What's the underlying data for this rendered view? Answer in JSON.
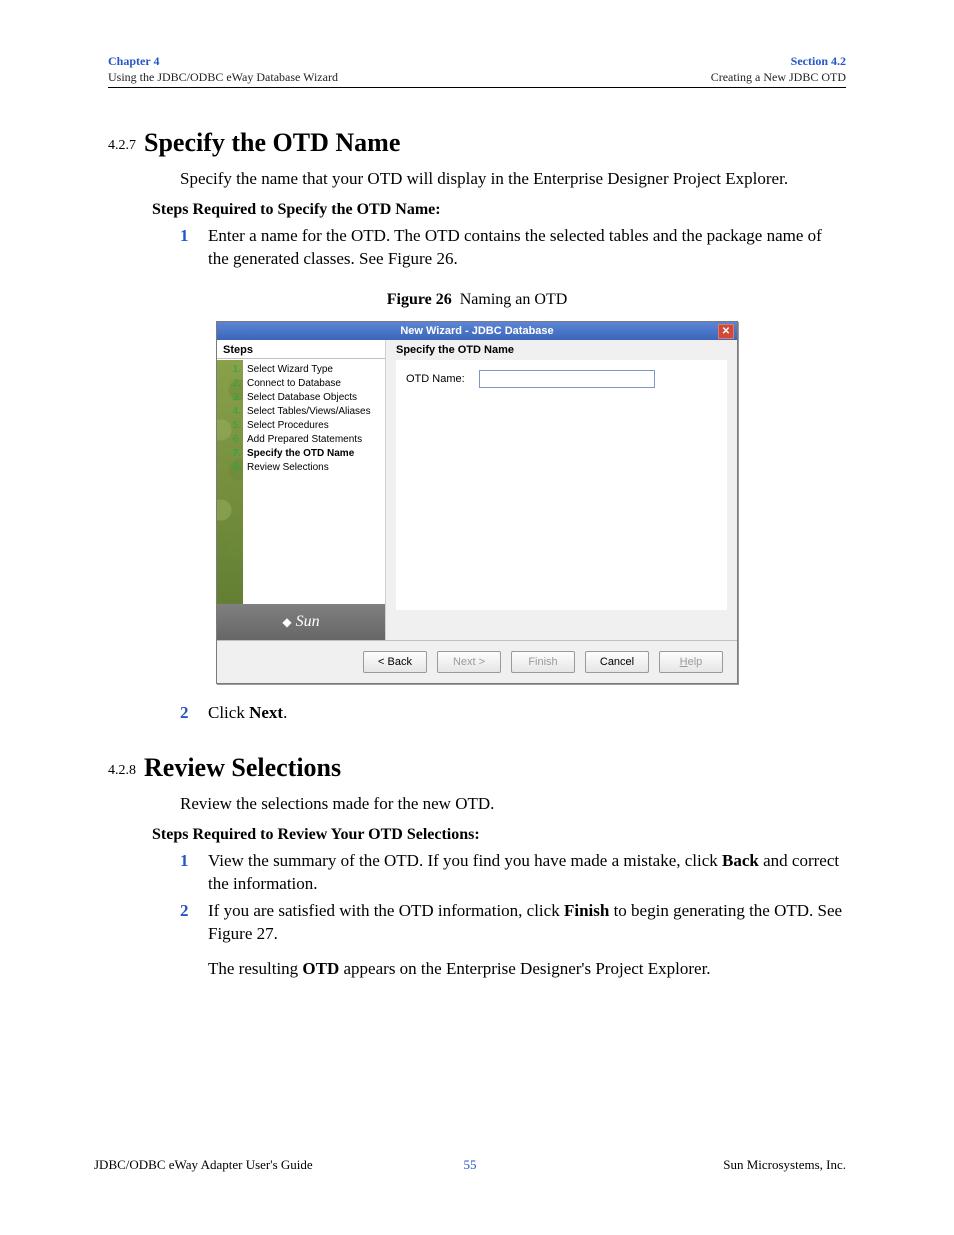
{
  "header": {
    "left_top": "Chapter 4",
    "left_bottom": "Using the JDBC/ODBC eWay Database Wizard",
    "right_top": "Section 4.2",
    "right_bottom": "Creating a New JDBC OTD"
  },
  "section1": {
    "num": "4.2.7",
    "title": "Specify the OTD Name",
    "intro": "Specify the name that your OTD will display in the Enterprise Designer Project Explorer.",
    "steps_header": "Steps Required to Specify the OTD Name:",
    "step1": "Enter a name for the OTD. The OTD contains the selected tables and the package name of the generated classes. See Figure 26.",
    "step2_a": "Click ",
    "step2_b": "Next",
    "step2_c": "."
  },
  "figure": {
    "label": "Figure 26",
    "caption": "Naming an OTD"
  },
  "dialog": {
    "title": "New Wizard - JDBC Database",
    "close_glyph": "✕",
    "steps_label": "Steps",
    "panel_caption": "Specify the OTD Name",
    "otd_label": "OTD Name:",
    "otd_value": "",
    "sun_text": "Sun",
    "steps": [
      "Select Wizard Type",
      "Connect to Database",
      "Select Database Objects",
      "Select Tables/Views/Aliases",
      "Select Procedures",
      "Add Prepared Statements",
      "Specify the OTD Name",
      "Review Selections"
    ],
    "buttons": {
      "back": "< Back",
      "next": "Next >",
      "finish": "Finish",
      "cancel": "Cancel",
      "help": "Help"
    }
  },
  "section2": {
    "num": "4.2.8",
    "title": "Review Selections",
    "intro": "Review the selections made for the new OTD.",
    "steps_header": "Steps Required to Review Your OTD Selections:",
    "s1a": "View the summary of the OTD. If you find you have made a mistake, click ",
    "s1b": "Back",
    "s1c": " and correct the information.",
    "s2a": "If you are satisfied with the OTD information, click ",
    "s2b": "Finish",
    "s2c": " to begin generating the OTD. See Figure 27.",
    "tail_a": "The resulting ",
    "tail_b": "OTD",
    "tail_c": " appears on the Enterprise Designer's Project Explorer."
  },
  "footer": {
    "left": "JDBC/ODBC eWay Adapter User's Guide",
    "page": "55",
    "right": "Sun Microsystems, Inc."
  }
}
